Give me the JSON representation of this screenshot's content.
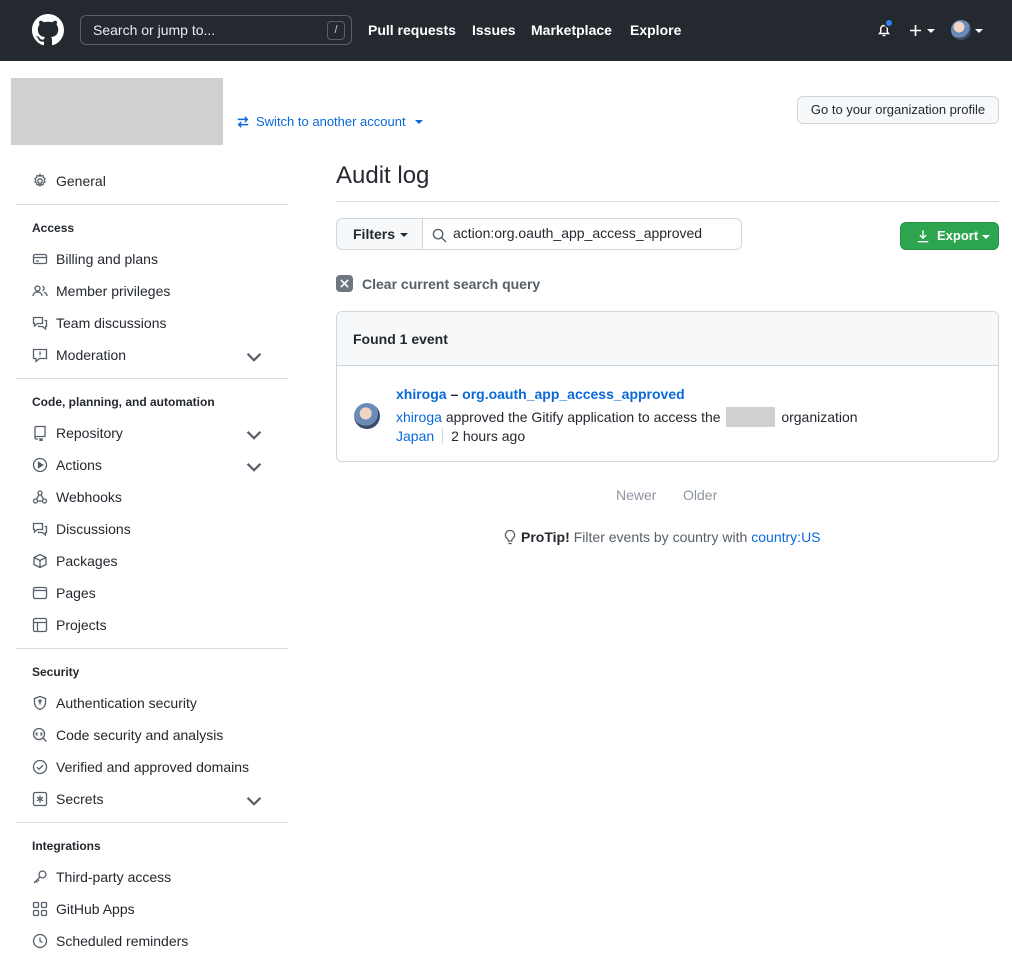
{
  "header": {
    "search_placeholder": "Search or jump to...",
    "search_shortcut": "/",
    "nav": [
      "Pull requests",
      "Issues",
      "Marketplace",
      "Explore"
    ],
    "notification_color": "#2f81f7"
  },
  "org": {
    "switch_label": "Switch to another account",
    "profile_button": "Go to your organization profile"
  },
  "sidebar": {
    "general": "General",
    "sections": [
      {
        "heading": "Access",
        "items": [
          "Billing and plans",
          "Member privileges",
          "Team discussions",
          "Moderation"
        ]
      },
      {
        "heading": "Code, planning, and automation",
        "items": [
          "Repository",
          "Actions",
          "Webhooks",
          "Discussions",
          "Packages",
          "Pages",
          "Projects"
        ]
      },
      {
        "heading": "Security",
        "items": [
          "Authentication security",
          "Code security and analysis",
          "Verified and approved domains",
          "Secrets"
        ]
      },
      {
        "heading": "Integrations",
        "items": [
          "Third-party access",
          "GitHub Apps",
          "Scheduled reminders"
        ]
      }
    ]
  },
  "main": {
    "title": "Audit log",
    "filters_label": "Filters",
    "search_value": "action:org.oauth_app_access_approved",
    "export_label": "Export",
    "export_color": "#2da44e",
    "clear_label": "Clear current search query",
    "found_label": "Found 1 event",
    "event": {
      "actor": "xhiroga",
      "dash": "–",
      "action": "org.oauth_app_access_approved",
      "desc_actor": "xhiroga",
      "desc_text": "approved the Gitify application to access the",
      "desc_suffix": "organization",
      "country": "Japan",
      "time": "2 hours ago"
    },
    "pager": {
      "newer": "Newer",
      "older": "Older"
    },
    "protip": {
      "label": "ProTip!",
      "text": "Filter events by country with",
      "link": "country:US"
    }
  }
}
